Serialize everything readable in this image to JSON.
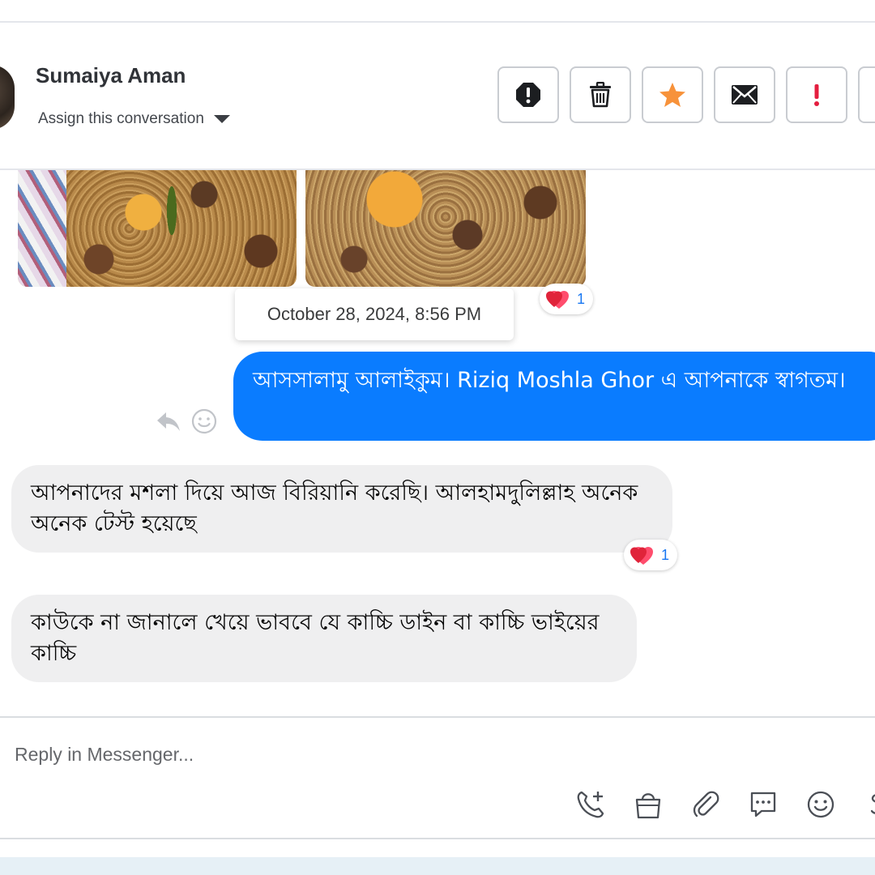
{
  "header": {
    "contact_name": "Sumaiya Aman",
    "assign_label": "Assign this conversation",
    "actions": [
      {
        "icon": "alert-octagon-icon"
      },
      {
        "icon": "trash-icon"
      },
      {
        "icon": "star-icon",
        "color": "#f7923a"
      },
      {
        "icon": "envelope-icon"
      },
      {
        "icon": "exclamation-icon",
        "color": "#e41e3f"
      },
      {
        "icon": "more-icon"
      }
    ]
  },
  "thread": {
    "photo_reaction": {
      "emoji": "heart-icon",
      "count": "1"
    },
    "timestamp": "October 28, 2024, 8:56 PM",
    "outgoing": {
      "text": "আসসালামু আলাইকুম। Riziq Moshla Ghor এ আপনাকে স্বাগতম।",
      "color": "#0a7cff"
    },
    "incoming": [
      {
        "text": "আপনাদের মশলা দিয়ে আজ বিরিয়ানি করেছি। আলহামদুলিল্লাহ অনেক অনেক টেস্ট হয়েছে",
        "reaction_count": "1"
      },
      {
        "text": "কাউকে না জানালে খেয়ে ভাববে যে কাচ্চি ডাইন বা কাচ্চি ভাইয়ের কাচ্চি"
      }
    ]
  },
  "composer": {
    "placeholder": "Reply in Messenger...",
    "tools": [
      "add-call-icon",
      "shopping-bag-icon",
      "paperclip-icon",
      "chat-bubble-icon",
      "emoji-icon",
      "dollar-icon"
    ]
  }
}
